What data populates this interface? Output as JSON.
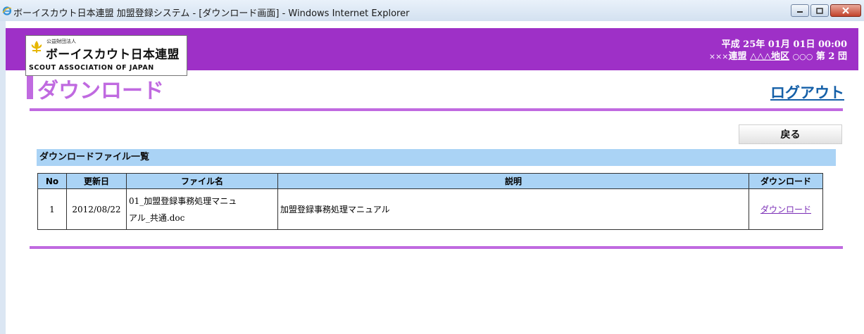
{
  "window": {
    "title": "ボーイスカウト日本連盟 加盟登録システム - [ダウンロード画面] - Windows Internet Explorer"
  },
  "header": {
    "logo_small": "公益財団法人",
    "logo_main": "ボーイスカウト日本連盟",
    "logo_en": "SCOUT ASSOCIATION OF JAPAN",
    "datetime": "平成 25年 01月 01日 00:00",
    "org_prefix": "×××",
    "org_federation": "連盟",
    "org_district": "△△△地区",
    "org_group_prefix": "○○○",
    "org_group": "第 2 団"
  },
  "page": {
    "title": "ダウンロード",
    "logout": "ログアウト",
    "back_button": "戻る",
    "section_title": "ダウンロードファイル一覧"
  },
  "table": {
    "headers": [
      "No",
      "更新日",
      "ファイル名",
      "説明",
      "ダウンロード"
    ],
    "rows": [
      {
        "no": "1",
        "date": "2012/08/22",
        "file_line1": "01_加盟登録事務処理マニュ",
        "file_line2": "アル_共通.doc",
        "desc": "加盟登録事務処理マニュアル",
        "link": "ダウンロード"
      }
    ]
  },
  "colors": {
    "banner": "#9e30c7",
    "accent": "#c06ae0",
    "table_header": "#aad3f5",
    "logout": "#1560a8"
  }
}
